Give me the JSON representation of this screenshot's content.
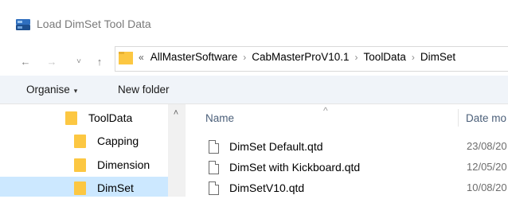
{
  "window": {
    "title": "Load DimSet Tool Data",
    "icon": "app-icon"
  },
  "nav_buttons": {
    "back": "←",
    "forward": "→",
    "recent": "˅",
    "up": "↑"
  },
  "address": {
    "overflow_glyph": "«",
    "separator": "›",
    "crumbs": [
      "AllMasterSoftware",
      "CabMasterProV10.1",
      "ToolData",
      "DimSet"
    ]
  },
  "toolbar": {
    "organise_label": "Organise",
    "organise_arrow": "▾",
    "new_folder_label": "New folder"
  },
  "nav_pane": {
    "scroll_up_glyph": "˄",
    "items": [
      {
        "label": "ToolData"
      },
      {
        "label": "Capping"
      },
      {
        "label": "Dimension"
      },
      {
        "label": "DimSet",
        "selected": true
      }
    ]
  },
  "file_list": {
    "sort_glyph": "^",
    "columns": {
      "name": "Name",
      "date": "Date mo"
    },
    "files": [
      {
        "name": "DimSet Default.qtd",
        "date": "23/08/20"
      },
      {
        "name": "DimSet with Kickboard.qtd",
        "date": "12/05/20"
      },
      {
        "name": "DimSetV10.qtd",
        "date": "10/08/20"
      }
    ]
  },
  "colors": {
    "folder": "#fcc742",
    "selection": "#cce8ff",
    "command_bar": "#f0f4f9",
    "column_header": "#4c607a"
  }
}
